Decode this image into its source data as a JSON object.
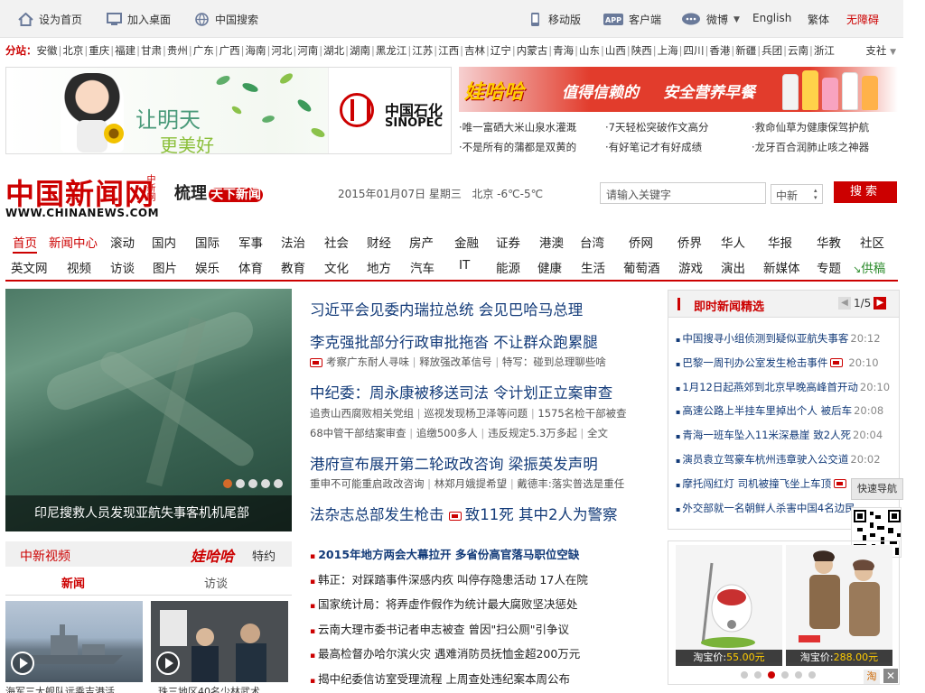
{
  "topbar": {
    "set_home": "设为首页",
    "add_desktop": "加入桌面",
    "china_search": "中国搜索",
    "mobile": "移动版",
    "client": "客户端",
    "weibo": "微博",
    "english": "English",
    "traditional": "繁体",
    "accessible": "无障碍"
  },
  "regions": {
    "label": "分站：",
    "items": [
      "安徽",
      "北京",
      "重庆",
      "福建",
      "甘肃",
      "贵州",
      "广东",
      "广西",
      "海南",
      "河北",
      "河南",
      "湖北",
      "湖南",
      "黑龙江",
      "江苏",
      "江西",
      "吉林",
      "辽宁",
      "内蒙古",
      "青海",
      "山东",
      "山西",
      "陕西",
      "上海",
      "四川",
      "香港",
      "新疆",
      "兵团",
      "云南",
      "浙江"
    ],
    "more": "支社"
  },
  "ads": {
    "left_text1": "让明天",
    "left_text2": "更美好",
    "sinopec_cn": "中国石化",
    "sinopec_en": "SINOPEC",
    "right_brand": "娃哈哈",
    "right_slogan1": "值得信赖的",
    "right_slogan2": "安全营养早餐",
    "links": [
      [
        "·唯一富硒大米山泉水灌溉",
        "·7天轻松突破作文高分",
        "·救命仙草为健康保驾护航"
      ],
      [
        "·不是所有的蒲都是双黄的",
        "·有好笔记才有好成绩",
        "·龙牙百合润肺止咳之神器"
      ]
    ]
  },
  "header": {
    "logo": "中国新闻网",
    "logo_side": "中新网",
    "url": "WWW.CHINANEWS.COM",
    "slogan": "梳理",
    "slogan_red": "天下新闻",
    "date": "2015年01月07日 星期三",
    "weather": "北京 -6℃-5℃",
    "search_placeholder": "请输入关键字",
    "search_scope": "中新",
    "search_button": "搜索"
  },
  "nav": {
    "row1": [
      "首页",
      "新闻中心",
      "滚动",
      "国内",
      "国际",
      "军事",
      "法治",
      "社会",
      "财经",
      "房产",
      "金融",
      "证券",
      "港澳",
      "台湾",
      "侨网",
      "侨界",
      "华人",
      "华报",
      "华教",
      "社区"
    ],
    "row2": [
      "英文网",
      "视频",
      "访谈",
      "图片",
      "娱乐",
      "体育",
      "教育",
      "文化",
      "地方",
      "汽车",
      "IT",
      "能源",
      "健康",
      "生活",
      "葡萄酒",
      "游戏",
      "演出",
      "新媒体",
      "专题",
      "供稿"
    ]
  },
  "hero": {
    "caption": "印尼搜救人员发现亚航失事客机机尾部"
  },
  "headlines": [
    {
      "title": "习近平会见委内瑞拉总统 会见巴哈马总理"
    },
    {
      "title": "李克强批部分行政审批拖沓 不让群众跑累腿",
      "subs": [
        "考察广东耐人寻味",
        "释放强改革信号",
        "特写：碰到总理聊些啥"
      ]
    },
    {
      "title": "中纪委：周永康被移送司法 令计划正立案审查",
      "subs": [
        "追责山西腐败相关党组",
        "巡视发现杨卫泽等问题",
        "1575名检干部被查"
      ],
      "subs2": [
        "68中管干部结案审查",
        "追缴500多人",
        "违反规定5.3万多起",
        "全文"
      ]
    },
    {
      "title": "港府宣布展开第二轮政改咨询 梁振英发声明",
      "subs": [
        "重申不可能重启政改咨询",
        "林郑月娥提希望",
        "戴德丰:落实普选是重任"
      ]
    },
    {
      "title": "法杂志总部发生枪击",
      "title2": "致11死 其中2人为警察"
    }
  ],
  "more_news": [
    "2015年地方两会大幕拉开 多省份高官落马职位空缺",
    "韩正：对踩踏事件深感内疚 叫停存隐患活动 17人在院",
    "国家统计局：将弄虚作假作为统计最大腐败坚决惩处",
    "云南大理市委书记者申志被查 曾因\"扫公厕\"引争议",
    "最高检督办哈尔滨火灾 遇难消防员抚恤金超200万元",
    "揭中纪委信访室受理流程 上周查处违纪案本周公布"
  ],
  "video": {
    "title": "中新视频",
    "sponsor_brand": "娃哈哈",
    "sponsor": "特约",
    "tab_news": "新闻",
    "tab_interview": "访谈",
    "captions": [
      "海军三大舰队远乘吉港活",
      "珠三地区40名少林武术"
    ]
  },
  "instant": {
    "title": "即时新闻精选",
    "page": "1/5",
    "items": [
      {
        "text": "中国搜寻小组侦测到疑似亚航失事客",
        "time": "20:12"
      },
      {
        "text": "巴黎一周刊办公室发生枪击事件",
        "time": "20:10",
        "video": true
      },
      {
        "text": "1月12日起燕郊到北京早晚高峰首开动",
        "time": "20:10"
      },
      {
        "text": "高速公路上半挂车里掉出个人 被后车",
        "time": "20:08"
      },
      {
        "text": "青海一班车坠入11米深悬崖 致2人死",
        "time": "20:04"
      },
      {
        "text": "演员袁立驾豪车杭州违章驶入公交道",
        "time": "20:02"
      },
      {
        "text": "摩托闯红灯 司机被撞飞坐上车顶",
        "time": "",
        "video": true
      },
      {
        "text": "外交部就一名朝鲜人杀害中国4名边民",
        "time": ""
      }
    ]
  },
  "quicknav": "快速导航",
  "taobao": {
    "items": [
      {
        "label": "淘宝价:",
        "price": "55.00元"
      },
      {
        "label": "淘宝价:",
        "price": "288.00元"
      }
    ],
    "mark": "淘",
    "close": "✕"
  }
}
